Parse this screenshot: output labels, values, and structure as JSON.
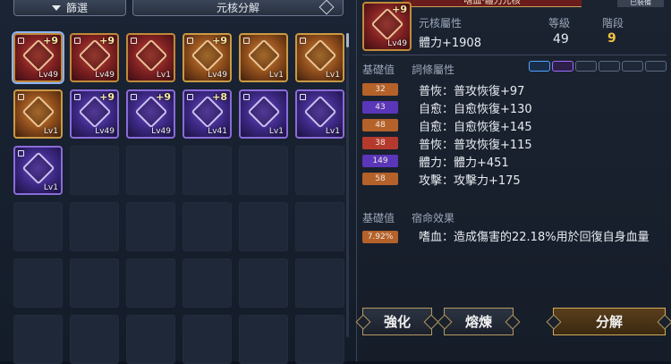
{
  "tabs": {
    "filter_label": "篩選",
    "core_decompose_label": "元核分解"
  },
  "selected_item": {
    "banner_text": "嗜血·體力元核",
    "equip_tag": "已裝備",
    "plus": "+9",
    "level": "Lv49",
    "attr_label": "元核屬性",
    "attr_value": "體力+1908",
    "level_label": "等級",
    "level_value": "49",
    "stage_label": "階段",
    "stage_value": "9"
  },
  "affix_section": {
    "base_label": "基礎值",
    "affix_label": "詞條屬性",
    "rows": [
      {
        "base": "32",
        "text": "普恢：普攻恢復+97",
        "color": "orange"
      },
      {
        "base": "43",
        "text": "自愈：自愈恢復+130",
        "color": "purple"
      },
      {
        "base": "48",
        "text": "自愈：自愈恢復+145",
        "color": "orange"
      },
      {
        "base": "38",
        "text": "普恢：普攻恢復+115",
        "color": "red"
      },
      {
        "base": "149",
        "text": "體力：體力+451",
        "color": "purple"
      },
      {
        "base": "58",
        "text": "攻擊：攻擊力+175",
        "color": "orange"
      }
    ]
  },
  "destiny_section": {
    "base_label": "基礎值",
    "label": "宿命效果",
    "badge": "7.92%",
    "text": "嗜血：造成傷害的22.18%用於回復自身血量"
  },
  "buttons": {
    "enhance": "強化",
    "smelt": "熔煉",
    "decompose": "分解"
  },
  "inventory": [
    {
      "type": "red",
      "plus": "+9",
      "level": "Lv49",
      "selected": true
    },
    {
      "type": "red",
      "plus": "+9",
      "level": "Lv49"
    },
    {
      "type": "red",
      "plus": "",
      "level": "Lv1"
    },
    {
      "type": "gold",
      "plus": "+9",
      "level": "Lv49"
    },
    {
      "type": "gold",
      "plus": "",
      "level": "Lv1"
    },
    {
      "type": "gold",
      "plus": "",
      "level": "Lv1"
    },
    {
      "type": "gold",
      "plus": "",
      "level": "Lv1"
    },
    {
      "type": "purple",
      "plus": "+9",
      "level": "Lv49"
    },
    {
      "type": "purple",
      "plus": "+9",
      "level": "Lv49"
    },
    {
      "type": "purple",
      "plus": "+8",
      "level": "Lv41"
    },
    {
      "type": "purple",
      "plus": "",
      "level": "Lv1"
    },
    {
      "type": "purple",
      "plus": "",
      "level": "Lv1"
    },
    {
      "type": "purple",
      "plus": "",
      "level": "Lv1"
    }
  ],
  "colors": {
    "orange": "#b4612a",
    "purple": "#5a36b8",
    "red": "#b53a2e",
    "gold_accent": "#d4ac5a",
    "stage_yellow": "#f3c440"
  }
}
